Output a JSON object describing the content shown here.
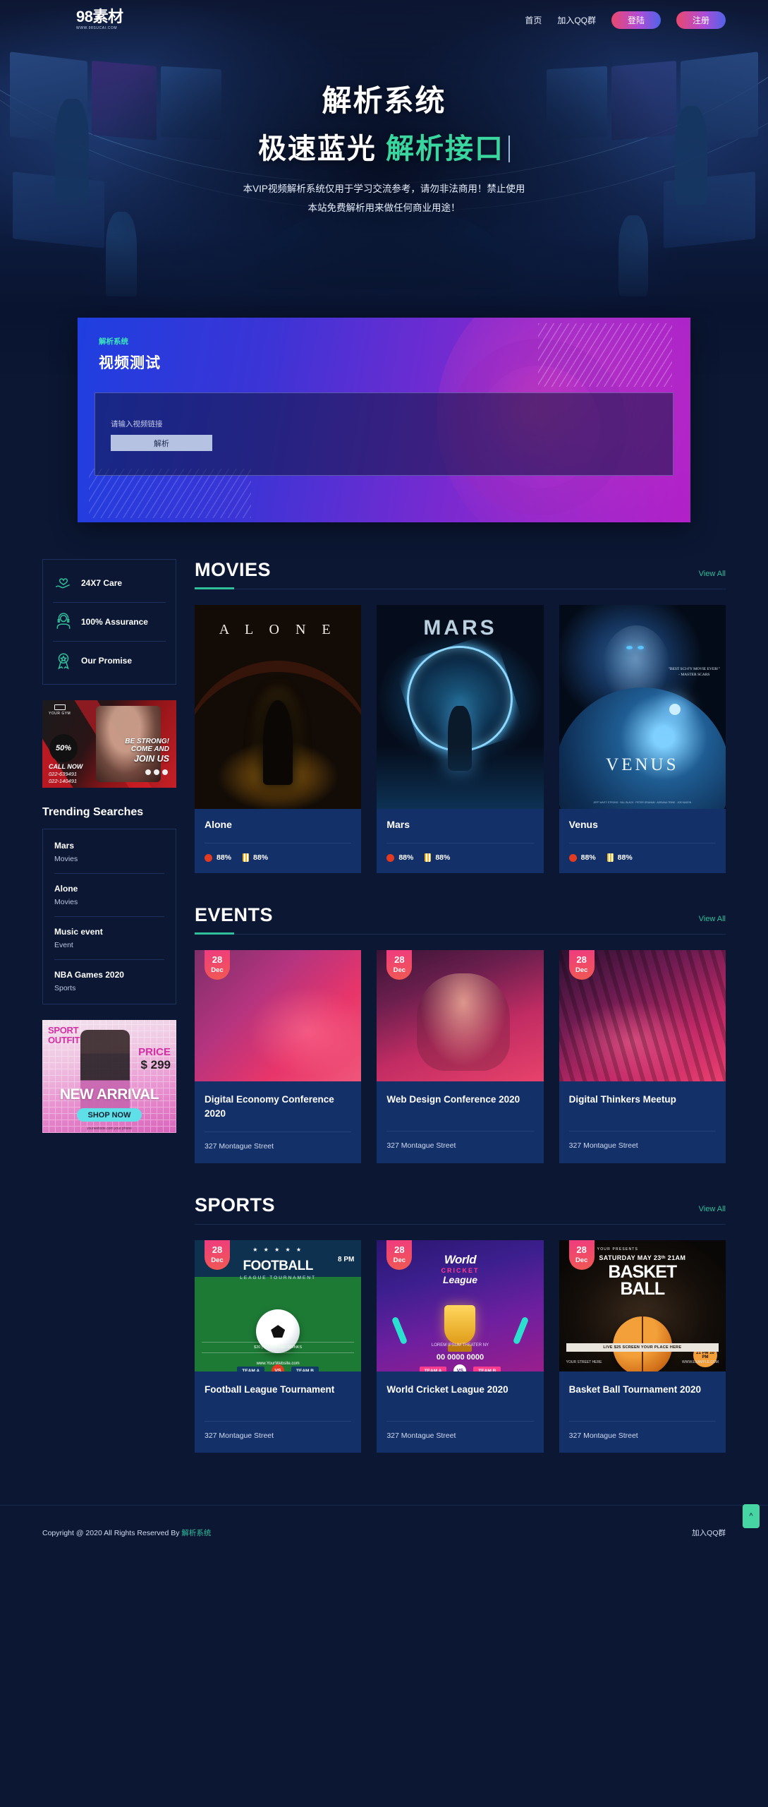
{
  "site": {
    "logo_main": "98素材",
    "logo_sub": "WWW.98SUCAI.COM"
  },
  "nav": {
    "links": [
      {
        "label": "首页",
        "name": "nav-home"
      },
      {
        "label": "加入QQ群",
        "name": "nav-qq-group"
      }
    ],
    "login_label": "登陆",
    "register_label": "注册"
  },
  "hero": {
    "line1": "解析系统",
    "line2_white": "极速蓝光",
    "line2_accent": "解析接口",
    "sub_line1": "本VIP视频解析系统仅用于学习交流参考，请勿非法商用！禁止使用",
    "sub_line2": "本站免费解析用来做任何商业用途！"
  },
  "parser": {
    "kicker": "解析系统",
    "title": "视频测试",
    "input_placeholder": "请输入视频链接",
    "input_value": "",
    "button_label": "解析"
  },
  "sidebar": {
    "features": [
      {
        "label": "24X7 Care",
        "icon": "heart-hand-icon"
      },
      {
        "label": "100% Assurance",
        "icon": "support-agent-icon"
      },
      {
        "label": "Our Promise",
        "icon": "award-badge-icon"
      }
    ],
    "ad_gym": {
      "logo": "YOUR GYM",
      "discount": "50%",
      "line1": "BE STRONG!",
      "line2": "COME AND",
      "line3": "JOIN US",
      "call_label": "CALL NOW",
      "phone1": "022-639491",
      "phone2": "022-140491"
    },
    "trending_title": "Trending Searches",
    "trending": [
      {
        "name": "Mars",
        "category": "Movies"
      },
      {
        "name": "Alone",
        "category": "Movies"
      },
      {
        "name": "Music event",
        "category": "Event"
      },
      {
        "name": "NBA Games 2020",
        "category": "Sports"
      }
    ],
    "ad_sport": {
      "line1": "SPORT",
      "line2": "OUTFIT",
      "price_label": "PRICE",
      "price_value": "$ 299",
      "headline": "NEW ARRIVAL",
      "cta": "SHOP NOW",
      "footer": "yourwebsite.com    your phone"
    }
  },
  "sections": {
    "movies": {
      "title": "MOVIES",
      "view_all": "View All",
      "cards": [
        {
          "name": "Alone",
          "poster_title": "A L O N E",
          "tomato": "88%",
          "popcorn": "88%"
        },
        {
          "name": "Mars",
          "poster_title": "MARS",
          "tomato": "88%",
          "popcorn": "88%"
        },
        {
          "name": "Venus",
          "poster_title": "VENUS",
          "poster_quote": "\"BEST SCI-FY MOVIE EVER!\"",
          "poster_quote_src": "- MASTER SCARS",
          "poster_credits": "JEFF WAITY STRONG · BILL BLACK · PETER GRAHAM · ADRIANA TRINE · JOE MASON",
          "tomato": "88%",
          "popcorn": "88%"
        }
      ]
    },
    "events": {
      "title": "EVENTS",
      "view_all": "View All",
      "cards": [
        {
          "day": "28",
          "month": "Dec",
          "title": "Digital Economy Conference 2020",
          "address": "327 Montague Street"
        },
        {
          "day": "28",
          "month": "Dec",
          "title": "Web Design Conference 2020",
          "address": "327 Montague Street"
        },
        {
          "day": "28",
          "month": "Dec",
          "title": "Digital Thinkers Meetup",
          "address": "327 Montague Street"
        }
      ]
    },
    "sports": {
      "title": "SPORTS",
      "view_all": "View All",
      "cards": [
        {
          "day": "28",
          "month": "Dec",
          "title": "Football League Tournament",
          "address": "327 Montague Street",
          "poster": {
            "main": "FOOTBALL",
            "sub": "LEAGUE TOURNAMENT",
            "time": "8 PM",
            "team_a": "TEAM  A",
            "team_b": "TEAM  B",
            "vs": "VS",
            "info": "$20 | 8 PM | FREE DRINKS",
            "site": "www.YourWebsite.com"
          }
        },
        {
          "day": "28",
          "month": "Dec",
          "title": "World Cricket League 2020",
          "address": "327 Montague Street",
          "poster": {
            "word": "World",
            "cricket": "CRICKET",
            "league": "League",
            "team_a": "TEAM A",
            "team_b": "TEAM B",
            "vs": "VS",
            "lorem": "LOREM IPSUM THEATER NY",
            "phone": "00 0000 0000"
          }
        },
        {
          "day": "28",
          "month": "Dec",
          "title": "Basket Ball Tournament 2020",
          "address": "327 Montague Street",
          "poster": {
            "presents": "YOUR PRESENTS",
            "date": "SATURDAY MAY 23ᵗʰ 21AM",
            "main1": "BASKET",
            "main2": "BALL",
            "badge": "21 PM 10 PM",
            "bar": "LIVE $25 SCREEN YOUR PLACE HERE",
            "foot_left": "YOUR STREET HERE",
            "foot_right": "WWW.EXAMPLE.COM"
          }
        }
      ]
    }
  },
  "footer": {
    "copyright_prefix": "Copyright @ 2020 All Rights Reserved By ",
    "copyright_brand": "解析系统",
    "qq_label": "加入QQ群",
    "to_top_icon": "chevron-up-icon"
  }
}
